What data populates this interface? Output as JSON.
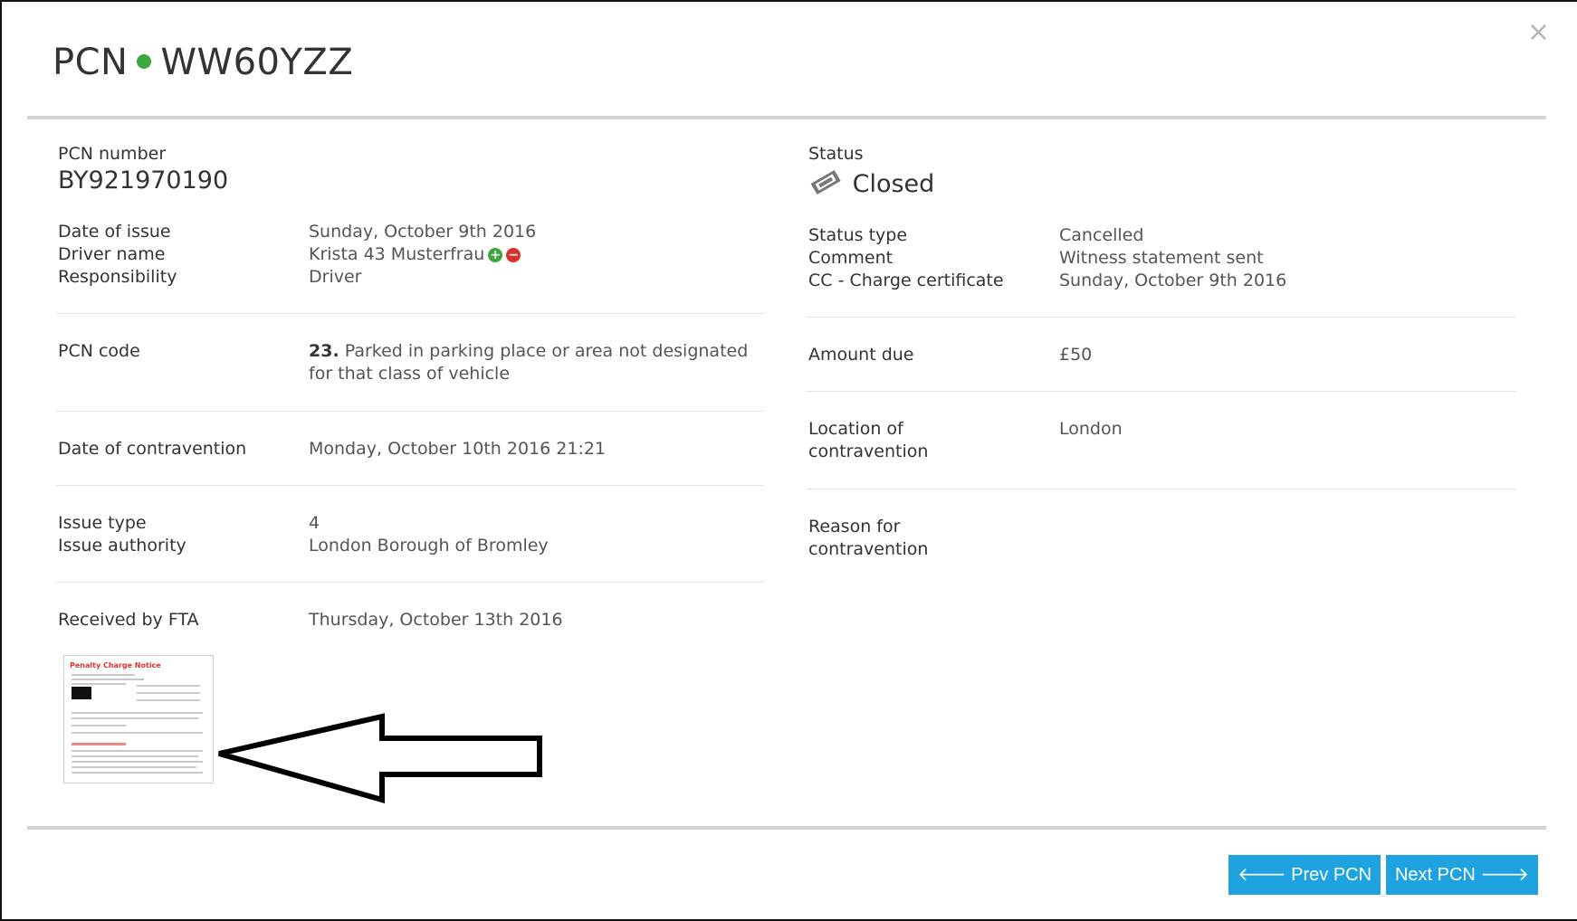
{
  "header": {
    "prefix": "PCN",
    "plate": "WW60YZZ",
    "close_glyph": "×",
    "dot_color": "#3aa83a"
  },
  "pcn_number": {
    "label": "PCN number",
    "value": "BY921970190"
  },
  "issue": {
    "date_label": "Date of issue",
    "date_value": "Sunday, October 9th 2016",
    "driver_label": "Driver name",
    "driver_value": "Krista 43 Musterfrau",
    "resp_label": "Responsibility",
    "resp_value": "Driver"
  },
  "pcn_code": {
    "label": "PCN code",
    "code": "23.",
    "desc_line1": "Parked in parking place or area not designated",
    "desc_line2": "for that class of vehicle"
  },
  "contravention_date": {
    "label": "Date of contravention",
    "value": "Monday, October 10th 2016 21:21"
  },
  "issue_info": {
    "type_label": "Issue type",
    "type_value": "4",
    "auth_label": "Issue authority",
    "auth_value": "London Borough of Bromley"
  },
  "received": {
    "label": "Received by FTA",
    "value": "Thursday, October 13th 2016"
  },
  "status": {
    "label": "Status",
    "value": "Closed"
  },
  "status_info": {
    "type_label": "Status type",
    "type_value": "Cancelled",
    "comment_label": "Comment",
    "comment_value": "Witness statement sent",
    "cc_label": "CC - Charge certificate",
    "cc_value": "Sunday, October 9th 2016"
  },
  "amount": {
    "label": "Amount due",
    "value": "£50"
  },
  "location": {
    "label_line1": "Location of",
    "label_line2": "contravention",
    "value": "London"
  },
  "reason": {
    "label_line1": "Reason for",
    "label_line2": "contravention"
  },
  "thumbnail": {
    "title": "Penalty Charge Notice"
  },
  "footer": {
    "prev_label": "Prev PCN",
    "next_label": "Next PCN"
  },
  "colors": {
    "accent": "#1fa3e0",
    "add": "#3aa83a",
    "remove": "#d9302c"
  }
}
